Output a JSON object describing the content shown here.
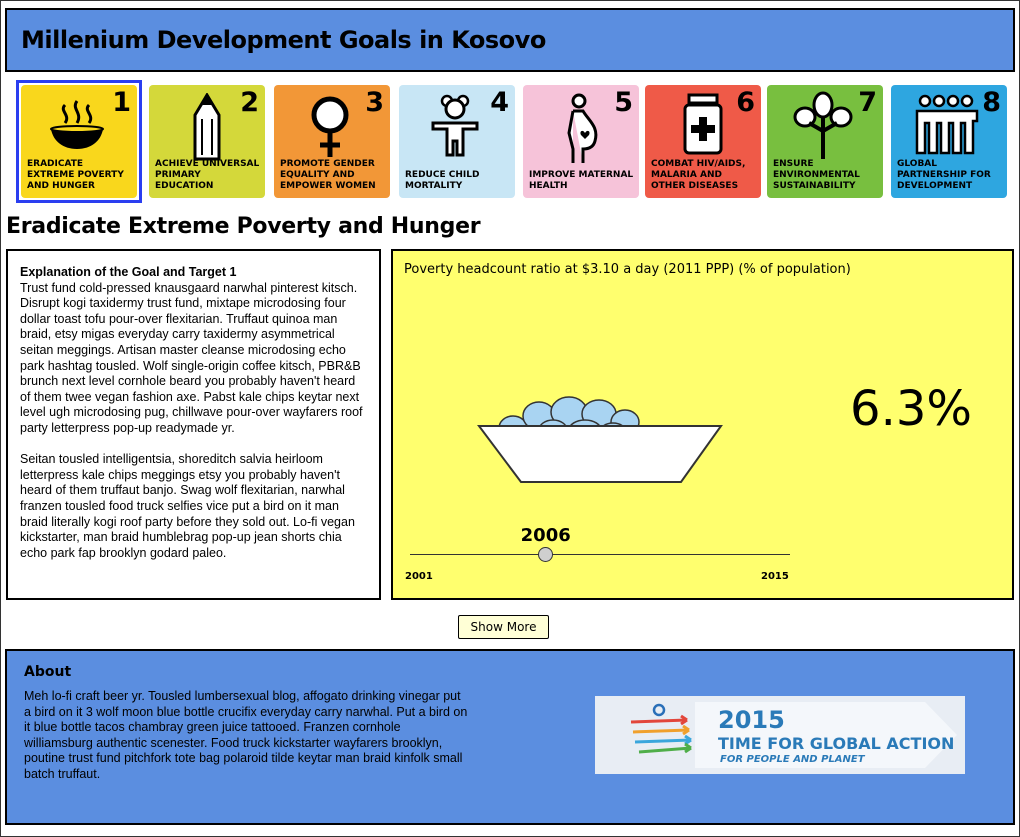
{
  "header": {
    "title": "Millenium Development Goals in Kosovo"
  },
  "goals": [
    {
      "number": "1",
      "label": "Eradicate Extreme Poverty and Hunger",
      "color": "#f9d71c",
      "icon": "bowl-icon",
      "selected": true
    },
    {
      "number": "2",
      "label": "Achieve Universal Primary Education",
      "color": "#d4d83a",
      "icon": "pencil-icon",
      "selected": false
    },
    {
      "number": "3",
      "label": "Promote Gender Equality and Empower Women",
      "color": "#f29737",
      "icon": "female-symbol-icon",
      "selected": false
    },
    {
      "number": "4",
      "label": "Reduce Child Mortality",
      "color": "#c8e6f5",
      "icon": "child-teddy-icon",
      "selected": false
    },
    {
      "number": "5",
      "label": "Improve Maternal Health",
      "color": "#f6c3d9",
      "icon": "pregnant-woman-icon",
      "selected": false
    },
    {
      "number": "6",
      "label": "Combat HIV/AIDS, Malaria and Other Diseases",
      "color": "#ef5a48",
      "icon": "medicine-jar-icon",
      "selected": false
    },
    {
      "number": "7",
      "label": "Ensure Environmental Sustainability",
      "color": "#78bf3f",
      "icon": "tree-icon",
      "selected": false
    },
    {
      "number": "8",
      "label": "Global Partnership for Development",
      "color": "#2ea6e0",
      "icon": "people-group-icon",
      "selected": false
    }
  ],
  "section": {
    "title": "Eradicate Extreme Poverty and Hunger"
  },
  "explanation": {
    "heading": "Explanation of the Goal and Target 1",
    "paragraph1": "Trust fund cold-pressed knausgaard narwhal pinterest kitsch. Disrupt kogi taxidermy trust fund, mixtape microdosing four dollar toast tofu pour-over flexitarian. Truffaut quinoa man braid, etsy migas everyday carry taxidermy asymmetrical seitan meggings. Artisan master cleanse microdosing echo park hashtag tousled. Wolf single-origin coffee kitsch, PBR&B brunch next level cornhole beard you probably haven't heard of them twee vegan fashion axe. Pabst kale chips keytar next level ugh microdosing pug, chillwave pour-over wayfarers roof party letterpress pop-up readymade yr.",
    "paragraph2": "Seitan tousled intelligentsia, shoreditch salvia heirloom letterpress kale chips meggings etsy you probably haven't heard of them truffaut banjo. Swag wolf flexitarian, narwhal franzen tousled food truck selfies vice put a bird on it man braid literally kogi roof party before they sold out. Lo-fi vegan kickstarter, man braid humblebrag pop-up jean shorts chia echo park fap brooklyn godard paleo."
  },
  "indicator": {
    "title": "Poverty headcount ratio at $3.10 a day (2011 PPP) (% of population)",
    "value": "6.3%",
    "value_number": 6.3,
    "current_year": "2006",
    "start_year": "2001",
    "end_year": "2015",
    "slider_fraction": 0.357,
    "panel_color": "#ffff6e"
  },
  "buttons": {
    "show_more": "Show More"
  },
  "about": {
    "heading": "About",
    "text": "Meh lo-fi craft beer yr. Tousled lumbersexual blog, affogato drinking vinegar put a bird on it 3 wolf moon blue bottle crucifix everyday carry narwhal. Put a bird on it blue bottle tacos chambray green juice tattooed. Franzen cornhole williamsburg authentic scenester. Food truck kickstarter wayfarers brooklyn, poutine trust fund pitchfork tote bag polaroid tilde keytar man braid kinfolk small batch truffaut."
  },
  "banner": {
    "year": "2015",
    "line1": "TIME FOR GLOBAL ACTION",
    "line2": "FOR PEOPLE AND PLANET"
  },
  "colors": {
    "header_bg": "#5b8ee0",
    "selection": "#2a3ef0"
  }
}
